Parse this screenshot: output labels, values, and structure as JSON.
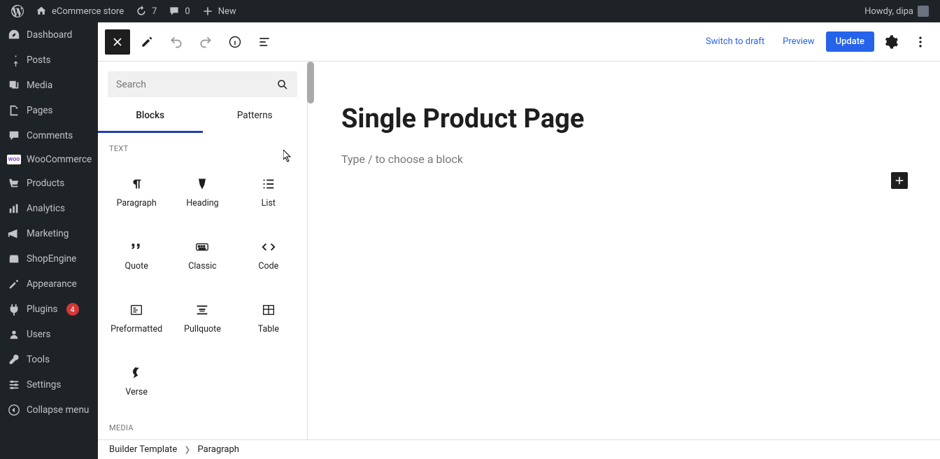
{
  "adminbar": {
    "site_name": "eCommerce store",
    "updates_count": "7",
    "comments_count": "0",
    "new_label": "New",
    "howdy": "Howdy, dipa"
  },
  "sidebar": {
    "items": [
      {
        "label": "Dashboard"
      },
      {
        "label": "Posts"
      },
      {
        "label": "Media"
      },
      {
        "label": "Pages"
      },
      {
        "label": "Comments"
      },
      {
        "label": "WooCommerce"
      },
      {
        "label": "Products"
      },
      {
        "label": "Analytics"
      },
      {
        "label": "Marketing"
      },
      {
        "label": "ShopEngine"
      },
      {
        "label": "Appearance"
      },
      {
        "label": "Plugins",
        "badge": "4"
      },
      {
        "label": "Users"
      },
      {
        "label": "Tools"
      },
      {
        "label": "Settings"
      },
      {
        "label": "Collapse menu"
      }
    ]
  },
  "toolbar": {
    "switch_draft": "Switch to draft",
    "preview": "Preview",
    "update": "Update"
  },
  "inserter": {
    "search_placeholder": "Search",
    "tabs": [
      {
        "label": "Blocks"
      },
      {
        "label": "Patterns"
      }
    ],
    "sections": {
      "text_title": "TEXT",
      "media_title": "MEDIA",
      "text_blocks": [
        {
          "label": "Paragraph"
        },
        {
          "label": "Heading"
        },
        {
          "label": "List"
        },
        {
          "label": "Quote"
        },
        {
          "label": "Classic"
        },
        {
          "label": "Code"
        },
        {
          "label": "Preformatted"
        },
        {
          "label": "Pullquote"
        },
        {
          "label": "Table"
        },
        {
          "label": "Verse"
        }
      ]
    }
  },
  "canvas": {
    "title": "Single Product Page",
    "placeholder": "Type / to choose a block"
  },
  "breadcrumb": {
    "parent": "Builder Template",
    "current": "Paragraph"
  }
}
